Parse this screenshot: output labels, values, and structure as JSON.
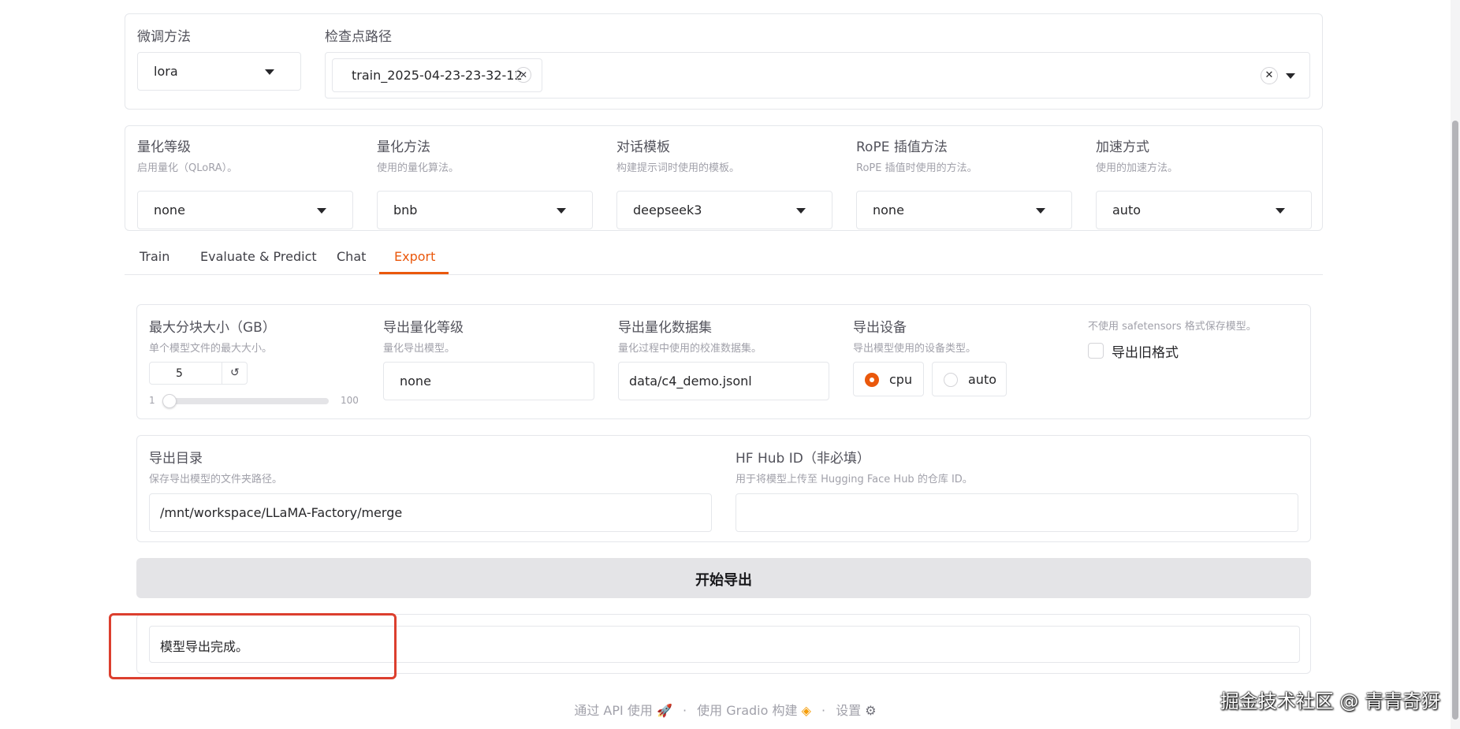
{
  "top": {
    "finetune_label": "微调方法",
    "finetune_value": "lora",
    "checkpoint_label": "检查点路径",
    "checkpoint_chip": "train_2025-04-23-23-32-12"
  },
  "quant": {
    "fields": [
      {
        "label": "量化等级",
        "info": "启用量化（QLoRA）。",
        "value": "none"
      },
      {
        "label": "量化方法",
        "info": "使用的量化算法。",
        "value": "bnb"
      },
      {
        "label": "对话模板",
        "info": "构建提示词时使用的模板。",
        "value": "deepseek3"
      },
      {
        "label": "RoPE 插值方法",
        "info": "RoPE 插值时使用的方法。",
        "value": "none"
      },
      {
        "label": "加速方式",
        "info": "使用的加速方法。",
        "value": "auto"
      }
    ]
  },
  "tabs": [
    {
      "label": "Train",
      "active": false
    },
    {
      "label": "Evaluate & Predict",
      "active": false
    },
    {
      "label": "Chat",
      "active": false
    },
    {
      "label": "Export",
      "active": true
    }
  ],
  "export": {
    "size_label": "最大分块大小（GB）",
    "size_info": "单个模型文件的最大大小。",
    "size_value": "5",
    "slider_min": "1",
    "slider_max": "100",
    "slider_level": 0.04,
    "quant_bit_label": "导出量化等级",
    "quant_bit_info": "量化导出模型。",
    "quant_bit_value": "none",
    "dataset_label": "导出量化数据集",
    "dataset_info": "量化过程中使用的校准数据集。",
    "dataset_value": "data/c4_demo.jsonl",
    "device_label": "导出设备",
    "device_info": "导出模型使用的设备类型。",
    "device_options": [
      "cpu",
      "auto"
    ],
    "device_selected": "cpu",
    "legacy_info": "不使用 safetensors 格式保存模型。",
    "legacy_label": "导出旧格式",
    "legacy_checked": false,
    "dir_label": "导出目录",
    "dir_info": "保存导出模型的文件夹路径。",
    "dir_value": "/mnt/workspace/LLaMA-Factory/merge",
    "hub_label": "HF Hub ID（非必填）",
    "hub_info": "用于将模型上传至 Hugging Face Hub 的仓库 ID。",
    "hub_value": "",
    "start_button": "开始导出",
    "output_value": "模型导出完成。"
  },
  "footer": {
    "api": "通过 API 使用",
    "sep": "·",
    "gradio": "使用 Gradio 构建",
    "settings": "设置"
  },
  "watermark": "掘金技术社区 @ 青青奇犽",
  "colors": {
    "accent": "#ea580c",
    "highlight_box": "#dc3f2e",
    "button_bg": "#e4e4e7"
  }
}
